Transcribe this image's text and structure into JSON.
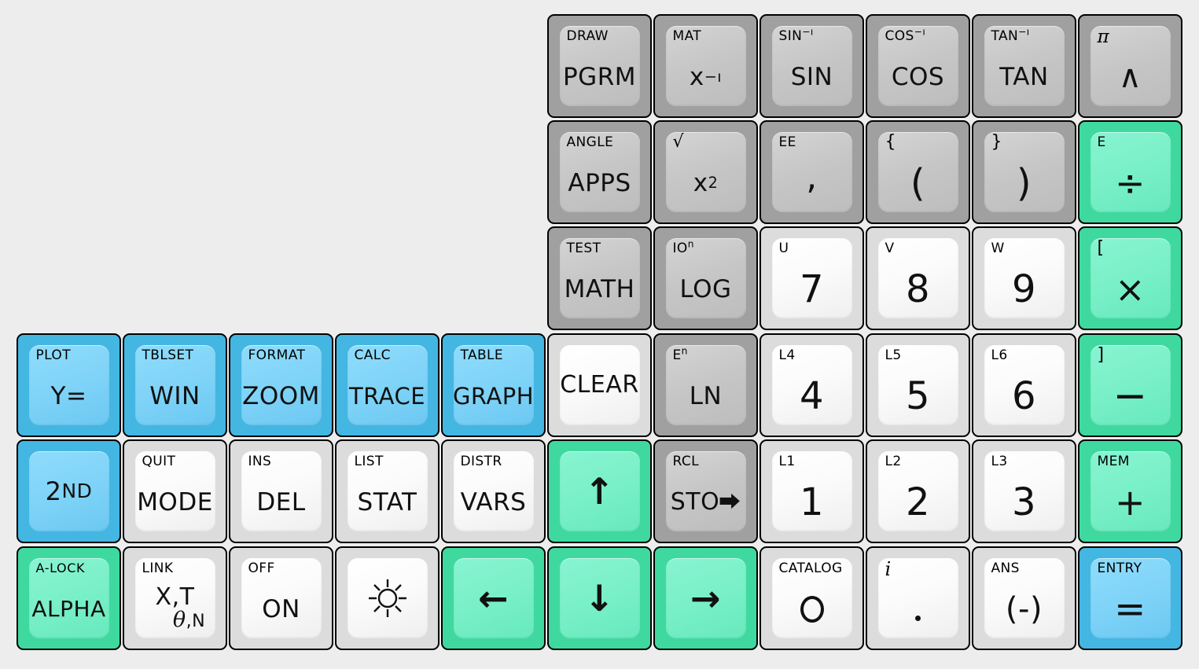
{
  "background_color": "#ededed",
  "palette": {
    "gray_dark_outer": "#a0a0a0",
    "gray_dark_inner": "#c6c6c6",
    "gray_light_outer": "#dcdcdc",
    "gray_light_inner": "#fbfbfb",
    "blue_outer": "#44b6e2",
    "blue_inner": "#80d4f8",
    "green_outer": "#3fd9a0",
    "green_inner": "#7af0c8",
    "border": "#000000",
    "label": "#111111"
  },
  "keys": [
    {
      "id": "pgrm",
      "sec": "DRAW",
      "pri": "PGRM",
      "color": "gray-dark",
      "col": 5,
      "row": 0
    },
    {
      "id": "xinv",
      "sec": "MAT",
      "pri": "x⁻¹",
      "color": "gray-dark",
      "col": 6,
      "row": 0
    },
    {
      "id": "sin",
      "sec": "SIN⁻¹",
      "pri": "SIN",
      "color": "gray-dark",
      "col": 7,
      "row": 0
    },
    {
      "id": "cos",
      "sec": "COS⁻¹",
      "pri": "COS",
      "color": "gray-dark",
      "col": 8,
      "row": 0
    },
    {
      "id": "tan",
      "sec": "TAN⁻¹",
      "pri": "TAN",
      "color": "gray-dark",
      "col": 9,
      "row": 0
    },
    {
      "id": "caret",
      "sec": "π",
      "pri": "∧",
      "color": "gray-dark",
      "col": 10,
      "row": 0
    },
    {
      "id": "apps",
      "sec": "ANGLE",
      "pri": "APPS",
      "color": "gray-dark",
      "col": 5,
      "row": 1
    },
    {
      "id": "xsq",
      "sec": "√",
      "pri": "x²",
      "color": "gray-dark",
      "col": 6,
      "row": 1
    },
    {
      "id": "comma",
      "sec": "EE",
      "pri": ",",
      "color": "gray-dark",
      "col": 7,
      "row": 1
    },
    {
      "id": "lparen",
      "sec": "{",
      "pri": "(",
      "color": "gray-dark",
      "col": 8,
      "row": 1
    },
    {
      "id": "rparen",
      "sec": "}",
      "pri": ")",
      "color": "gray-dark",
      "col": 9,
      "row": 1
    },
    {
      "id": "divide",
      "sec": "E",
      "pri": "÷",
      "color": "green",
      "col": 10,
      "row": 1
    },
    {
      "id": "math",
      "sec": "TEST",
      "pri": "MATH",
      "color": "gray-dark",
      "col": 5,
      "row": 2
    },
    {
      "id": "log",
      "sec": "10ⁿ",
      "pri": "LOG",
      "color": "gray-dark",
      "col": 6,
      "row": 2
    },
    {
      "id": "seven",
      "sec": "U",
      "pri": "7",
      "color": "gray-light",
      "col": 7,
      "row": 2
    },
    {
      "id": "eight",
      "sec": "V",
      "pri": "8",
      "color": "gray-light",
      "col": 8,
      "row": 2
    },
    {
      "id": "nine",
      "sec": "W",
      "pri": "9",
      "color": "gray-light",
      "col": 9,
      "row": 2
    },
    {
      "id": "multiply",
      "sec": "[",
      "pri": "×",
      "color": "green",
      "col": 10,
      "row": 2
    },
    {
      "id": "yequals",
      "sec": "PLOT",
      "pri": "Y=",
      "color": "blue",
      "col": 0,
      "row": 3
    },
    {
      "id": "win",
      "sec": "TBLSET",
      "pri": "WIN",
      "color": "blue",
      "col": 1,
      "row": 3
    },
    {
      "id": "zoom",
      "sec": "FORMAT",
      "pri": "ZOOM",
      "color": "blue",
      "col": 2,
      "row": 3
    },
    {
      "id": "trace",
      "sec": "CALC",
      "pri": "TRACE",
      "color": "blue",
      "col": 3,
      "row": 3
    },
    {
      "id": "graph",
      "sec": "TABLE",
      "pri": "GRAPH",
      "color": "blue",
      "col": 4,
      "row": 3
    },
    {
      "id": "clear",
      "sec": "",
      "pri": "CLEAR",
      "color": "gray-light",
      "col": 5,
      "row": 3
    },
    {
      "id": "ln",
      "sec": "Eⁿ",
      "pri": "LN",
      "color": "gray-dark",
      "col": 6,
      "row": 3
    },
    {
      "id": "four",
      "sec": "L4",
      "pri": "4",
      "color": "gray-light",
      "col": 7,
      "row": 3
    },
    {
      "id": "five",
      "sec": "L5",
      "pri": "5",
      "color": "gray-light",
      "col": 8,
      "row": 3
    },
    {
      "id": "six",
      "sec": "L6",
      "pri": "6",
      "color": "gray-light",
      "col": 9,
      "row": 3
    },
    {
      "id": "minus",
      "sec": "]",
      "pri": "−",
      "color": "green",
      "col": 10,
      "row": 3
    },
    {
      "id": "second",
      "sec": "",
      "pri": "2ND",
      "color": "blue",
      "col": 0,
      "row": 4
    },
    {
      "id": "mode",
      "sec": "QUIT",
      "pri": "MODE",
      "color": "gray-light",
      "col": 1,
      "row": 4
    },
    {
      "id": "del",
      "sec": "INS",
      "pri": "DEL",
      "color": "gray-light",
      "col": 2,
      "row": 4
    },
    {
      "id": "stat",
      "sec": "LIST",
      "pri": "STAT",
      "color": "gray-light",
      "col": 3,
      "row": 4
    },
    {
      "id": "vars",
      "sec": "DISTR",
      "pri": "VARS",
      "color": "gray-light",
      "col": 4,
      "row": 4
    },
    {
      "id": "up",
      "sec": "",
      "pri": "↑",
      "color": "green",
      "col": 5,
      "row": 4
    },
    {
      "id": "sto",
      "sec": "RCL",
      "pri": "STO⮕",
      "color": "gray-dark",
      "col": 6,
      "row": 4
    },
    {
      "id": "one",
      "sec": "L1",
      "pri": "1",
      "color": "gray-light",
      "col": 7,
      "row": 4
    },
    {
      "id": "two",
      "sec": "L2",
      "pri": "2",
      "color": "gray-light",
      "col": 8,
      "row": 4
    },
    {
      "id": "three",
      "sec": "L3",
      "pri": "3",
      "color": "gray-light",
      "col": 9,
      "row": 4
    },
    {
      "id": "plus",
      "sec": "MEM",
      "pri": "+",
      "color": "green",
      "col": 10,
      "row": 4
    },
    {
      "id": "alpha",
      "sec": "A-LOCK",
      "pri": "ALPHA",
      "color": "green",
      "col": 0,
      "row": 5
    },
    {
      "id": "xtthetan",
      "sec": "LINK",
      "pri": "X,T θ,N",
      "color": "gray-light",
      "col": 1,
      "row": 5
    },
    {
      "id": "on",
      "sec": "OFF",
      "pri": "ON",
      "color": "gray-light",
      "col": 2,
      "row": 5
    },
    {
      "id": "brightness",
      "sec": "",
      "pri": "☀",
      "color": "gray-light",
      "col": 3,
      "row": 5
    },
    {
      "id": "left",
      "sec": "",
      "pri": "←",
      "color": "green",
      "col": 4,
      "row": 5
    },
    {
      "id": "down",
      "sec": "",
      "pri": "↓",
      "color": "green",
      "col": 5,
      "row": 5
    },
    {
      "id": "right",
      "sec": "",
      "pri": "→",
      "color": "green",
      "col": 6,
      "row": 5
    },
    {
      "id": "zero",
      "sec": "CATALOG",
      "pri": "0",
      "color": "gray-light",
      "col": 7,
      "row": 5
    },
    {
      "id": "period",
      "sec": "i",
      "pri": ".",
      "color": "gray-light",
      "col": 8,
      "row": 5
    },
    {
      "id": "negate",
      "sec": "ANS",
      "pri": "(-)",
      "color": "gray-light",
      "col": 9,
      "row": 5
    },
    {
      "id": "enter",
      "sec": "ENTRY",
      "pri": "=",
      "color": "blue",
      "col": 10,
      "row": 5
    }
  ],
  "xt_key": {
    "line1": "X,T",
    "line2_theta": "θ",
    "line2_rest": ",N"
  }
}
